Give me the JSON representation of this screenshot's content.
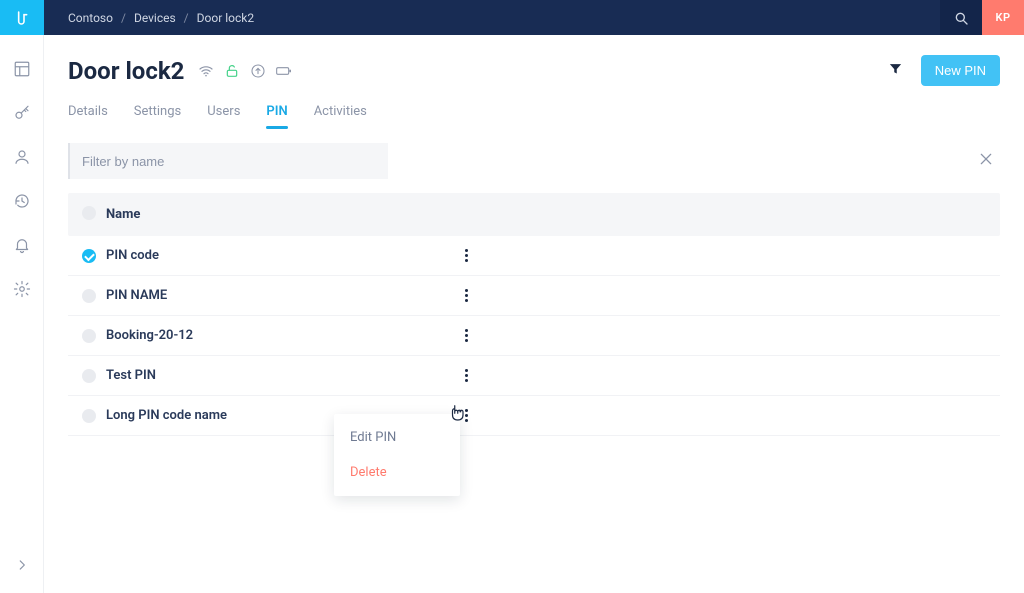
{
  "breadcrumb": {
    "org": "Contoso",
    "section": "Devices",
    "item": "Door lock2"
  },
  "user": {
    "initials": "KP"
  },
  "page": {
    "title": "Door lock2"
  },
  "actions": {
    "new_pin": "New PIN"
  },
  "tabs": [
    {
      "label": "Details"
    },
    {
      "label": "Settings"
    },
    {
      "label": "Users"
    },
    {
      "label": "PIN",
      "active": true
    },
    {
      "label": "Activities"
    }
  ],
  "filter": {
    "placeholder": "Filter by name"
  },
  "table": {
    "header": {
      "name": "Name"
    },
    "rows": [
      {
        "name": "PIN code",
        "active": true
      },
      {
        "name": "PIN NAME",
        "active": false
      },
      {
        "name": "Booking-20-12",
        "active": false
      },
      {
        "name": "Test PIN",
        "active": false
      },
      {
        "name": "Long PIN code name",
        "active": false
      }
    ]
  },
  "context_menu": {
    "edit": "Edit PIN",
    "delete": "Delete"
  }
}
